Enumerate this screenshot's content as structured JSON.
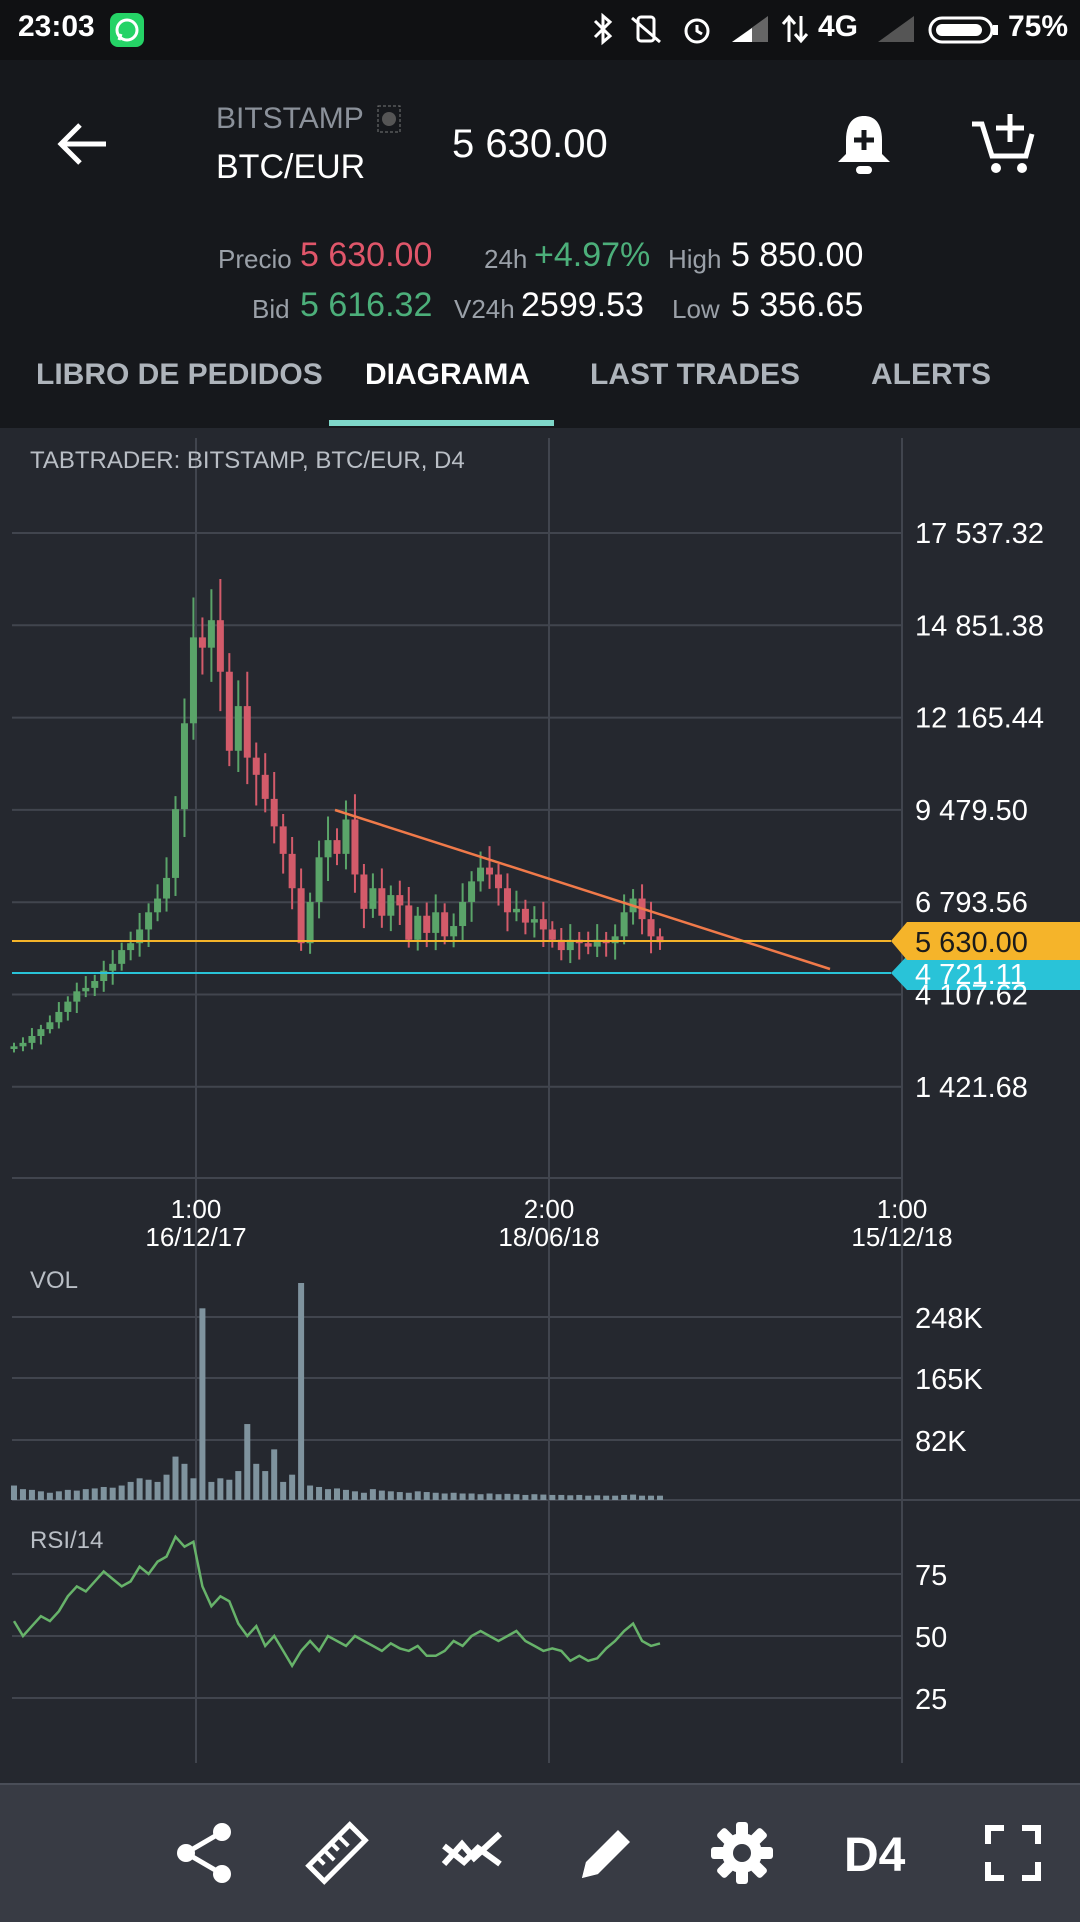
{
  "status": {
    "time": "23:03",
    "network": "4G",
    "battery": "75%",
    "icons": [
      "whatsapp-icon",
      "bluetooth-icon",
      "vibrate-icon",
      "alarm-icon",
      "signal-icon",
      "data-icon",
      "signal-weak-icon",
      "battery-icon"
    ]
  },
  "header": {
    "exchange": "BITSTAMP",
    "pair": "BTC/EUR",
    "price": "5 630.00",
    "icons": [
      "back-arrow-icon",
      "bitstamp-logo-icon",
      "bell-plus-icon",
      "cart-plus-icon"
    ]
  },
  "ticker": {
    "precio_label": "Precio",
    "precio_value": "5 630.00",
    "bid_label": "Bid",
    "bid_value": "5 616.32",
    "h24_label": "24h",
    "h24_value": "+4.97%",
    "v24h_label": "V24h",
    "v24h_value": "2599.53",
    "high_label": "High",
    "high_value": "5 850.00",
    "low_label": "Low",
    "low_value": "5 356.65"
  },
  "tabs": [
    {
      "label": "LIBRO DE PEDIDOS"
    },
    {
      "label": "DIAGRAMA",
      "active": true
    },
    {
      "label": "LAST TRADES"
    },
    {
      "label": "ALERTS"
    }
  ],
  "colors": {
    "accent": "#7ed6c8",
    "up": "#5aa469",
    "down": "#d35b6a",
    "price_line": "#f5b42a",
    "low_line": "#29c3d8",
    "trendline": "#f07a4a",
    "volume": "#7f939e",
    "rsi": "#67b36a"
  },
  "chart_data": [
    {
      "type": "candlestick",
      "title": "TABTRADER: BITSTAMP, BTC/EUR, D4",
      "y_ticks": [
        "17 537.32",
        "14 851.38",
        "12 165.44",
        "9 479.50",
        "6 793.56",
        "4 107.62",
        "1 421.68"
      ],
      "ylim": [
        0,
        19000
      ],
      "x_ticks": [
        {
          "time": "1:00",
          "date": "16/12/17"
        },
        {
          "time": "2:00",
          "date": "18/06/18"
        },
        {
          "time": "1:00",
          "date": "15/12/18"
        }
      ],
      "price_marker": "5 630.00",
      "low_marker": "4 721.11",
      "closes": [
        2600,
        2700,
        2900,
        3100,
        3300,
        3600,
        3900,
        4200,
        4300,
        4500,
        4800,
        5000,
        5400,
        5600,
        6000,
        6500,
        6900,
        7500,
        9500,
        12000,
        14500,
        14200,
        15000,
        13500,
        11200,
        12500,
        11000,
        10500,
        9800,
        9000,
        8200,
        7200,
        5600,
        6800,
        8100,
        8600,
        8200,
        9200,
        7600,
        6600,
        7200,
        6400,
        7000,
        6700,
        5700,
        6400,
        5900,
        6500,
        5800,
        6100,
        6800,
        7400,
        7800,
        7600,
        7200,
        6500,
        6600,
        6200,
        6300,
        6000,
        5700,
        5400,
        5700,
        5600,
        5500,
        5700,
        5600,
        5800,
        6500,
        6900,
        6300,
        5800,
        5630
      ],
      "x_range": [
        "2017-07",
        "2018-12"
      ]
    },
    {
      "type": "bar",
      "title": "VOL",
      "y_ticks": [
        "248K",
        "165K",
        "82K"
      ],
      "ylim": [
        0,
        300000
      ],
      "values": [
        20000,
        15000,
        14000,
        12000,
        10000,
        12000,
        14000,
        13000,
        15000,
        16000,
        18000,
        17000,
        20000,
        25000,
        30000,
        28000,
        25000,
        35000,
        60000,
        50000,
        30000,
        265000,
        25000,
        30000,
        28000,
        40000,
        105000,
        50000,
        40000,
        70000,
        25000,
        35000,
        300000,
        20000,
        18000,
        15000,
        16000,
        14000,
        12000,
        10000,
        15000,
        13000,
        12000,
        11000,
        10000,
        12000,
        11000,
        10000,
        9000,
        10000,
        9000,
        9000,
        8000,
        9000,
        8000,
        8500,
        8000,
        7000,
        8000,
        7500,
        7000,
        7000,
        6500,
        7000,
        6000,
        6500,
        6000,
        6000,
        7000,
        7500,
        6000,
        6000,
        6000
      ],
      "x_range": [
        "2017-07",
        "2018-12"
      ]
    },
    {
      "type": "line",
      "title": "RSI/14",
      "y_ticks": [
        "75",
        "50",
        "25"
      ],
      "ylim": [
        0,
        100
      ],
      "values": [
        56,
        50,
        54,
        58,
        56,
        60,
        66,
        70,
        68,
        72,
        76,
        73,
        70,
        72,
        78,
        75,
        80,
        82,
        90,
        86,
        88,
        70,
        62,
        66,
        64,
        55,
        50,
        54,
        46,
        50,
        44,
        38,
        44,
        48,
        44,
        50,
        48,
        46,
        50,
        48,
        46,
        44,
        47,
        45,
        44,
        46,
        42,
        42,
        44,
        48,
        46,
        50,
        52,
        50,
        48,
        50,
        52,
        48,
        46,
        44,
        45,
        44,
        40,
        42,
        40,
        41,
        45,
        48,
        52,
        55,
        48,
        46,
        47
      ],
      "x_range": [
        "2017-07",
        "2018-12"
      ]
    }
  ],
  "toolbar": {
    "timeframe": "D4",
    "icons": [
      "share-icon",
      "ruler-icon",
      "indicators-icon",
      "pencil-icon",
      "settings-gear-icon",
      "fullscreen-icon"
    ]
  }
}
